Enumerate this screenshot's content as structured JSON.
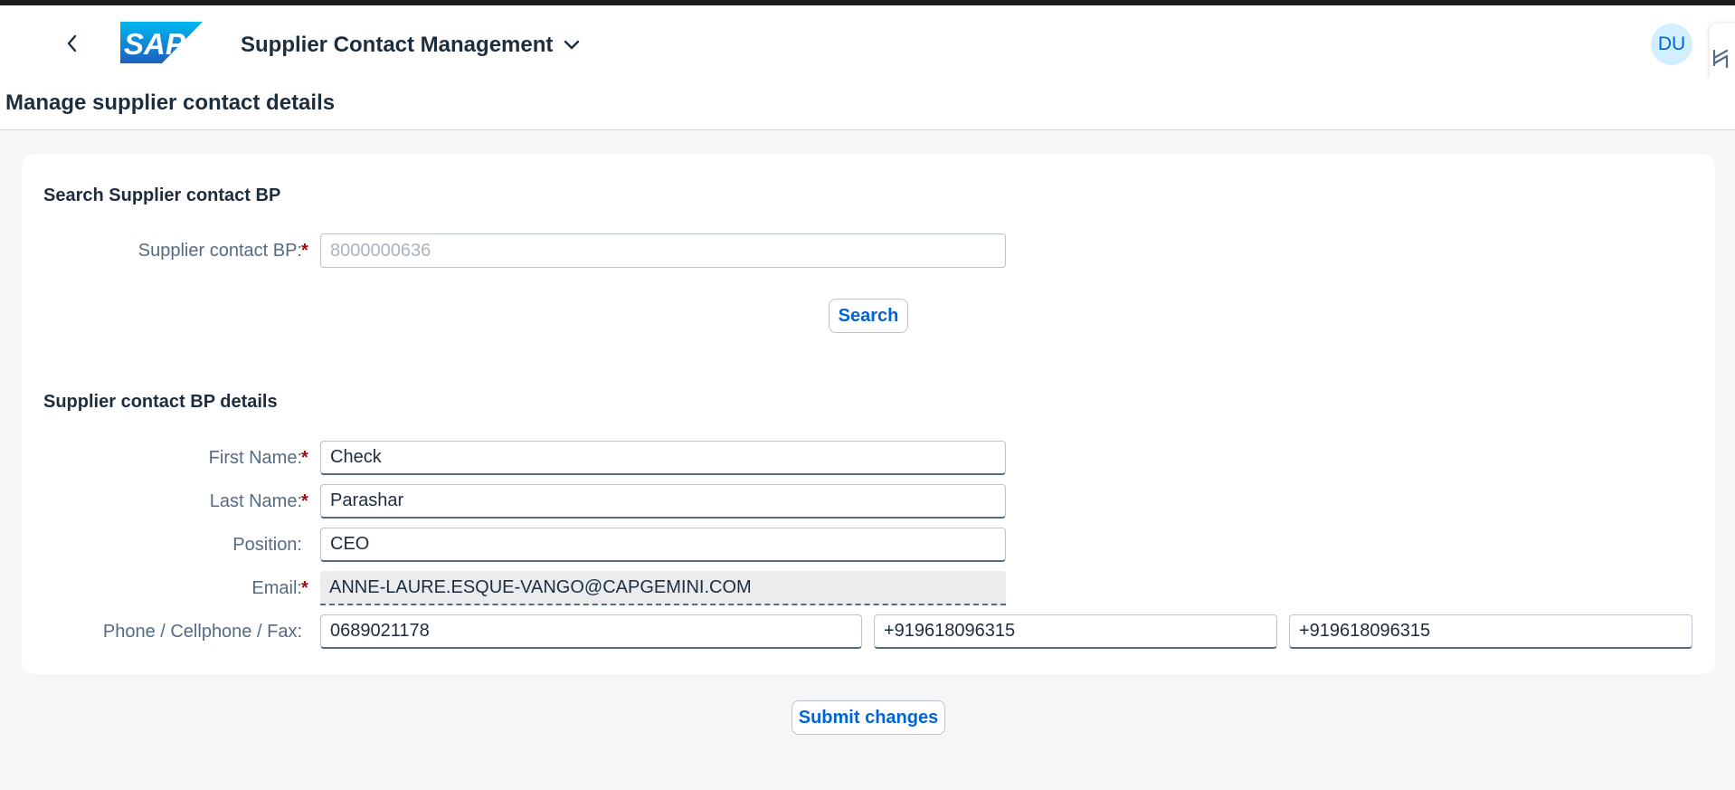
{
  "shell": {
    "app_title": "Supplier Contact Management",
    "user_initials": "DU",
    "logo_text": "SAP"
  },
  "page": {
    "title": "Manage supplier contact details"
  },
  "search_section": {
    "title": "Search Supplier contact BP",
    "bp_label": "Supplier contact BP:",
    "bp_placeholder": "8000000636",
    "search_button": "Search"
  },
  "details_section": {
    "title": "Supplier contact BP details",
    "first_name_label": "First Name:",
    "first_name_value": "Check",
    "last_name_label": "Last Name:",
    "last_name_value": "Parashar",
    "position_label": "Position:",
    "position_value": "CEO",
    "email_label": "Email:",
    "email_value": "ANNE-LAURE.ESQUE-VANGO@CAPGEMINI.COM",
    "phone_label": "Phone / Cellphone / Fax:",
    "phone_value": "0689021178",
    "cellphone_value": "+919618096315",
    "fax_value": "+919618096315"
  },
  "actions": {
    "submit_button": "Submit changes"
  },
  "colors": {
    "brand_blue": "#0064d9",
    "required_mark": "#aa0808",
    "background": "#f5f6f7"
  }
}
